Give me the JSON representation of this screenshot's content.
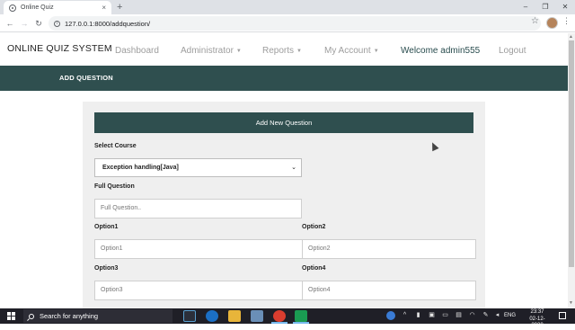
{
  "browser": {
    "tab_title": "Online Quiz",
    "tab_close": "×",
    "new_tab": "+",
    "url": "127.0.0.1:8000/addquestion/",
    "controls": {
      "minimize": "–",
      "maximize": "❐",
      "close": "✕"
    },
    "nav": {
      "back": "←",
      "forward": "→",
      "reload": "↻"
    }
  },
  "site": {
    "brand": "ONLINE QUIZ SYSTEM",
    "nav": {
      "dashboard": "Dashboard",
      "administrator": "Administrator",
      "reports": "Reports",
      "my_account": "My Account",
      "welcome": "Welcome admin555",
      "logout": "Logout"
    },
    "banner_title": "ADD QUESTION"
  },
  "form": {
    "header": "Add New Question",
    "select_course_label": "Select Course",
    "course_selected": "Exception handling[Java]",
    "full_question_label": "Full Question",
    "full_question_placeholder": "Full Question..",
    "option1_label": "Option1",
    "option1_placeholder": "Option1",
    "option2_label": "Option2",
    "option2_placeholder": "Option2",
    "option3_label": "Option3",
    "option3_placeholder": "Option3",
    "option4_label": "Option4",
    "option4_placeholder": "Option4"
  },
  "taskbar": {
    "search_placeholder": "Search for anything",
    "language": "ENG",
    "time": "23:37",
    "date": "02-12-2020"
  },
  "colors": {
    "accent": "#2f4f4f",
    "panel": "#efefef",
    "taskbar": "#1f1f27"
  }
}
